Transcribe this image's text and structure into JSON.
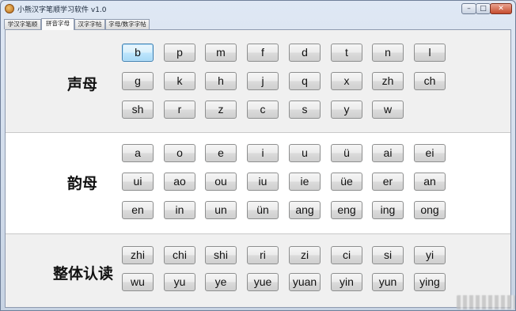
{
  "window": {
    "title": "小熊汉字笔顺学习软件 v1.0",
    "controls": {
      "minimize": "–",
      "maximize": "□",
      "close": "✕"
    }
  },
  "tabs": [
    {
      "label": "学汉字笔顺",
      "active": false
    },
    {
      "label": "拼音字母",
      "active": true
    },
    {
      "label": "汉字字帖",
      "active": false
    },
    {
      "label": "字母/数字字帖",
      "active": false
    }
  ],
  "sections": {
    "shengmu": {
      "label": "声母",
      "rows": [
        [
          "b",
          "p",
          "m",
          "f",
          "d",
          "t",
          "n",
          "l"
        ],
        [
          "g",
          "k",
          "h",
          "j",
          "q",
          "x",
          "zh",
          "ch"
        ],
        [
          "sh",
          "r",
          "z",
          "c",
          "s",
          "y",
          "w"
        ]
      ]
    },
    "yunmu": {
      "label": "韵母",
      "rows": [
        [
          "a",
          "o",
          "e",
          "i",
          "u",
          "ü",
          "ai",
          "ei"
        ],
        [
          "ui",
          "ao",
          "ou",
          "iu",
          "ie",
          "üe",
          "er",
          "an"
        ],
        [
          "en",
          "in",
          "un",
          "ün",
          "ang",
          "eng",
          "ing",
          "ong"
        ]
      ]
    },
    "zhengti": {
      "label": "整体认读",
      "rows": [
        [
          "zhi",
          "chi",
          "shi",
          "ri",
          "zi",
          "ci",
          "si",
          "yi"
        ],
        [
          "wu",
          "yu",
          "ye",
          "yue",
          "yuan",
          "yin",
          "yun",
          "ying"
        ]
      ]
    }
  },
  "selected_key": "b",
  "colors": {
    "window_frame": "#c7d3e3",
    "close_button": "#c54b2d",
    "selected_button": "#bee6fd",
    "panel_bg": "#f0f0f0",
    "panel_white": "#ffffff"
  }
}
